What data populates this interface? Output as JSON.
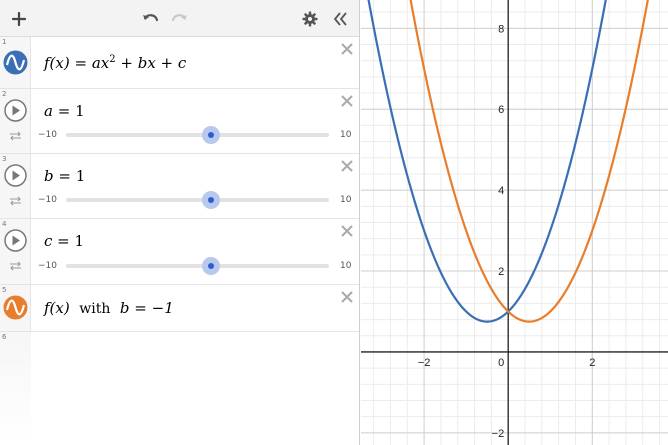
{
  "toolbar": {
    "add_icon": "plus-icon",
    "undo_icon": "undo-icon",
    "redo_icon": "redo-icon",
    "settings_icon": "gear-icon",
    "collapse_icon": "double-chevron-left-icon"
  },
  "expressions": [
    {
      "index": "1",
      "type": "function",
      "color": "#3a6eb5",
      "lhs": "f(x)",
      "rhs_prefix": "ax",
      "exponent": "2",
      "rhs_suffix": " + bx + c"
    },
    {
      "index": "2",
      "type": "slider",
      "var": "a",
      "value": "1",
      "min": "−10",
      "max": "10"
    },
    {
      "index": "3",
      "type": "slider",
      "var": "b",
      "value": "1",
      "min": "−10",
      "max": "10"
    },
    {
      "index": "4",
      "type": "slider",
      "var": "c",
      "value": "1",
      "min": "−10",
      "max": "10"
    },
    {
      "index": "5",
      "type": "function",
      "color": "#e87d2c",
      "lhs": "f(x)",
      "with_text": "with",
      "condition": "b = −1"
    },
    {
      "index": "6",
      "type": "empty"
    }
  ],
  "graph": {
    "x_tick_labels": [
      "−2",
      "0",
      "2"
    ],
    "y_tick_labels": [
      "8",
      "6",
      "4",
      "2",
      "−2"
    ],
    "x_ticks": [
      -2,
      0,
      2
    ],
    "y_ticks": [
      8,
      6,
      4,
      2,
      -2
    ],
    "xlim": [
      -3.5,
      3.8
    ],
    "ylim": [
      -2.3,
      8.7
    ],
    "grid": true,
    "curves": [
      {
        "name": "f(x)",
        "color": "#3a6eb5",
        "a": 1,
        "b": 1,
        "c": 1
      },
      {
        "name": "f(x) with b = −1",
        "color": "#e87d2c",
        "a": 1,
        "b": -1,
        "c": 1
      }
    ]
  }
}
